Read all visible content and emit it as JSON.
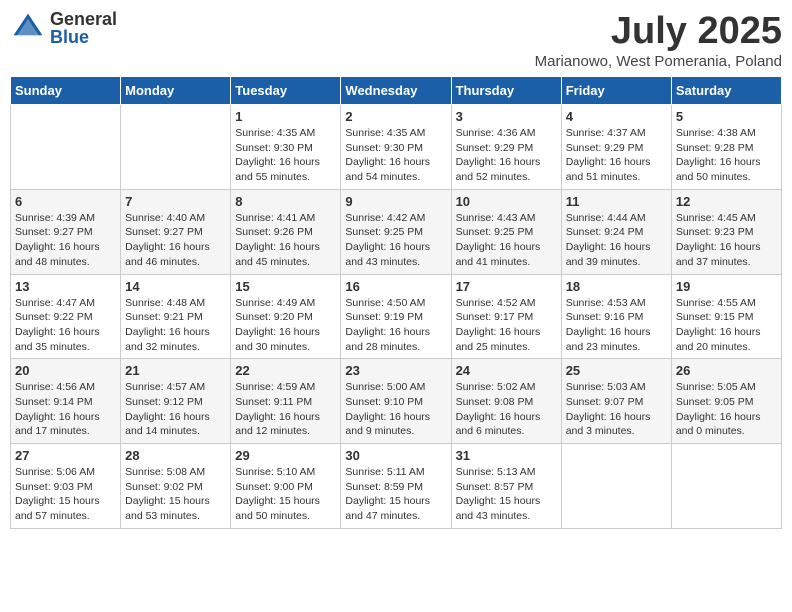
{
  "logo": {
    "general": "General",
    "blue": "Blue"
  },
  "title": "July 2025",
  "location": "Marianowo, West Pomerania, Poland",
  "headers": [
    "Sunday",
    "Monday",
    "Tuesday",
    "Wednesday",
    "Thursday",
    "Friday",
    "Saturday"
  ],
  "weeks": [
    [
      {
        "day": "",
        "info": ""
      },
      {
        "day": "",
        "info": ""
      },
      {
        "day": "1",
        "info": "Sunrise: 4:35 AM\nSunset: 9:30 PM\nDaylight: 16 hours\nand 55 minutes."
      },
      {
        "day": "2",
        "info": "Sunrise: 4:35 AM\nSunset: 9:30 PM\nDaylight: 16 hours\nand 54 minutes."
      },
      {
        "day": "3",
        "info": "Sunrise: 4:36 AM\nSunset: 9:29 PM\nDaylight: 16 hours\nand 52 minutes."
      },
      {
        "day": "4",
        "info": "Sunrise: 4:37 AM\nSunset: 9:29 PM\nDaylight: 16 hours\nand 51 minutes."
      },
      {
        "day": "5",
        "info": "Sunrise: 4:38 AM\nSunset: 9:28 PM\nDaylight: 16 hours\nand 50 minutes."
      }
    ],
    [
      {
        "day": "6",
        "info": "Sunrise: 4:39 AM\nSunset: 9:27 PM\nDaylight: 16 hours\nand 48 minutes."
      },
      {
        "day": "7",
        "info": "Sunrise: 4:40 AM\nSunset: 9:27 PM\nDaylight: 16 hours\nand 46 minutes."
      },
      {
        "day": "8",
        "info": "Sunrise: 4:41 AM\nSunset: 9:26 PM\nDaylight: 16 hours\nand 45 minutes."
      },
      {
        "day": "9",
        "info": "Sunrise: 4:42 AM\nSunset: 9:25 PM\nDaylight: 16 hours\nand 43 minutes."
      },
      {
        "day": "10",
        "info": "Sunrise: 4:43 AM\nSunset: 9:25 PM\nDaylight: 16 hours\nand 41 minutes."
      },
      {
        "day": "11",
        "info": "Sunrise: 4:44 AM\nSunset: 9:24 PM\nDaylight: 16 hours\nand 39 minutes."
      },
      {
        "day": "12",
        "info": "Sunrise: 4:45 AM\nSunset: 9:23 PM\nDaylight: 16 hours\nand 37 minutes."
      }
    ],
    [
      {
        "day": "13",
        "info": "Sunrise: 4:47 AM\nSunset: 9:22 PM\nDaylight: 16 hours\nand 35 minutes."
      },
      {
        "day": "14",
        "info": "Sunrise: 4:48 AM\nSunset: 9:21 PM\nDaylight: 16 hours\nand 32 minutes."
      },
      {
        "day": "15",
        "info": "Sunrise: 4:49 AM\nSunset: 9:20 PM\nDaylight: 16 hours\nand 30 minutes."
      },
      {
        "day": "16",
        "info": "Sunrise: 4:50 AM\nSunset: 9:19 PM\nDaylight: 16 hours\nand 28 minutes."
      },
      {
        "day": "17",
        "info": "Sunrise: 4:52 AM\nSunset: 9:17 PM\nDaylight: 16 hours\nand 25 minutes."
      },
      {
        "day": "18",
        "info": "Sunrise: 4:53 AM\nSunset: 9:16 PM\nDaylight: 16 hours\nand 23 minutes."
      },
      {
        "day": "19",
        "info": "Sunrise: 4:55 AM\nSunset: 9:15 PM\nDaylight: 16 hours\nand 20 minutes."
      }
    ],
    [
      {
        "day": "20",
        "info": "Sunrise: 4:56 AM\nSunset: 9:14 PM\nDaylight: 16 hours\nand 17 minutes."
      },
      {
        "day": "21",
        "info": "Sunrise: 4:57 AM\nSunset: 9:12 PM\nDaylight: 16 hours\nand 14 minutes."
      },
      {
        "day": "22",
        "info": "Sunrise: 4:59 AM\nSunset: 9:11 PM\nDaylight: 16 hours\nand 12 minutes."
      },
      {
        "day": "23",
        "info": "Sunrise: 5:00 AM\nSunset: 9:10 PM\nDaylight: 16 hours\nand 9 minutes."
      },
      {
        "day": "24",
        "info": "Sunrise: 5:02 AM\nSunset: 9:08 PM\nDaylight: 16 hours\nand 6 minutes."
      },
      {
        "day": "25",
        "info": "Sunrise: 5:03 AM\nSunset: 9:07 PM\nDaylight: 16 hours\nand 3 minutes."
      },
      {
        "day": "26",
        "info": "Sunrise: 5:05 AM\nSunset: 9:05 PM\nDaylight: 16 hours\nand 0 minutes."
      }
    ],
    [
      {
        "day": "27",
        "info": "Sunrise: 5:06 AM\nSunset: 9:03 PM\nDaylight: 15 hours\nand 57 minutes."
      },
      {
        "day": "28",
        "info": "Sunrise: 5:08 AM\nSunset: 9:02 PM\nDaylight: 15 hours\nand 53 minutes."
      },
      {
        "day": "29",
        "info": "Sunrise: 5:10 AM\nSunset: 9:00 PM\nDaylight: 15 hours\nand 50 minutes."
      },
      {
        "day": "30",
        "info": "Sunrise: 5:11 AM\nSunset: 8:59 PM\nDaylight: 15 hours\nand 47 minutes."
      },
      {
        "day": "31",
        "info": "Sunrise: 5:13 AM\nSunset: 8:57 PM\nDaylight: 15 hours\nand 43 minutes."
      },
      {
        "day": "",
        "info": ""
      },
      {
        "day": "",
        "info": ""
      }
    ]
  ]
}
